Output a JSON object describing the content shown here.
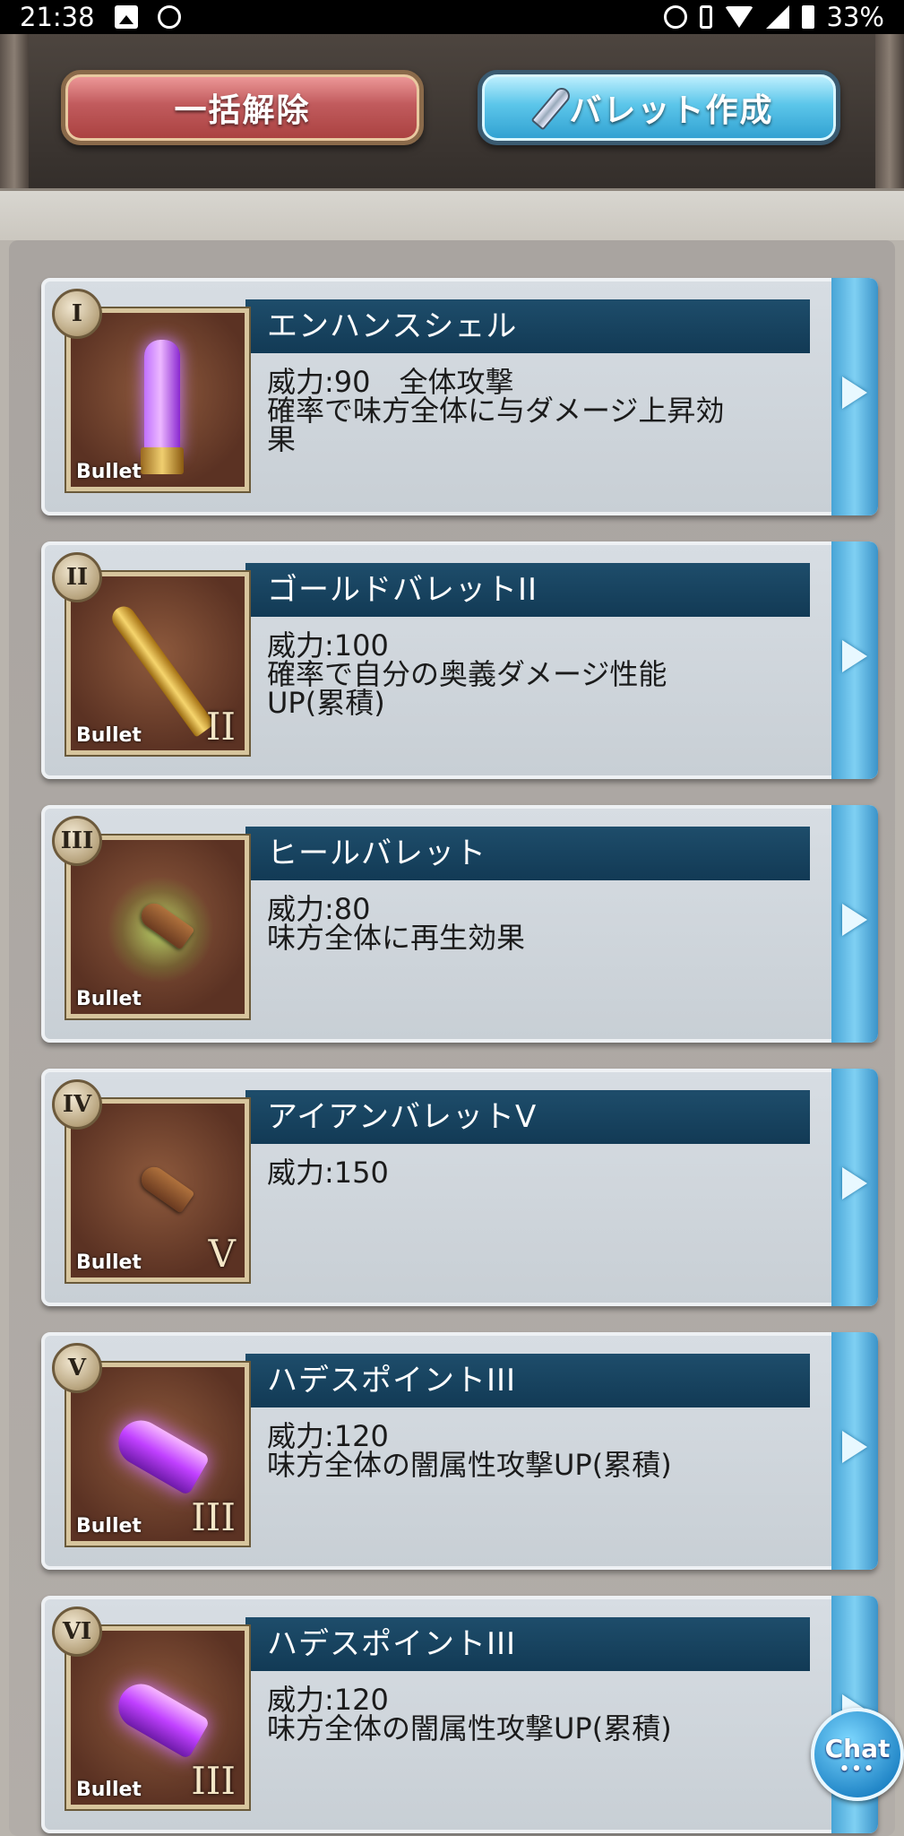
{
  "status_bar": {
    "time": "21:38",
    "battery": "33%",
    "icons": [
      "image-icon",
      "game-icon",
      "alarm-icon",
      "vibrate-icon",
      "wifi-icon",
      "signal-icon",
      "battery-icon"
    ]
  },
  "header": {
    "release_all_label": "一括解除",
    "create_bullet_label": "バレット作成"
  },
  "bullets": [
    {
      "badge": "I",
      "name": "エンハンスシェル",
      "thumb_label": "Bullet",
      "level": "",
      "desc": [
        "威力:90　全体攻撃",
        "確率で味方全体に与ダメージ上昇効",
        "果"
      ]
    },
    {
      "badge": "II",
      "name": "ゴールドバレットII",
      "thumb_label": "Bullet",
      "level": "II",
      "desc": [
        "威力:100",
        "確率で自分の奥義ダメージ性能",
        "UP(累積)"
      ]
    },
    {
      "badge": "III",
      "name": "ヒールバレット",
      "thumb_label": "Bullet",
      "level": "",
      "desc": [
        "威力:80",
        "味方全体に再生効果"
      ]
    },
    {
      "badge": "IV",
      "name": "アイアンバレットV",
      "thumb_label": "Bullet",
      "level": "V",
      "desc": [
        "威力:150"
      ]
    },
    {
      "badge": "V",
      "name": "ハデスポイントIII",
      "thumb_label": "Bullet",
      "level": "III",
      "desc": [
        "威力:120",
        "味方全体の闇属性攻撃UP(累積)"
      ]
    },
    {
      "badge": "VI",
      "name": "ハデスポイントIII",
      "thumb_label": "Bullet",
      "level": "III",
      "desc": [
        "威力:120",
        "味方全体の闇属性攻撃UP(累積)"
      ]
    }
  ],
  "chat": {
    "label": "Chat",
    "dots": "•••"
  }
}
